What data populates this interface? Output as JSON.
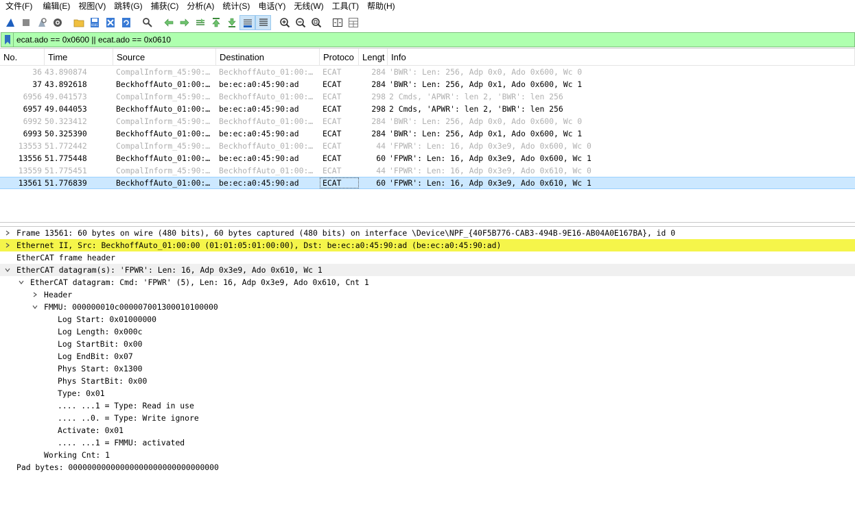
{
  "menu": [
    "文件(F)",
    "编辑(E)",
    "视图(V)",
    "跳转(G)",
    "捕获(C)",
    "分析(A)",
    "统计(S)",
    "电话(Y)",
    "无线(W)",
    "工具(T)",
    "帮助(H)"
  ],
  "toolbar": {
    "icons": [
      "shark-fin-start-icon",
      "stop-icon",
      "restart-icon",
      "options-gear-icon",
      "open-folder-icon",
      "save-file-icon",
      "close-file-icon",
      "reload-icon",
      "find-icon",
      "go-back-icon",
      "go-forward-icon",
      "go-to-packet-icon",
      "go-first-icon",
      "go-last-icon",
      "autoscroll-icon",
      "colorize-icon",
      "zoom-in-icon",
      "zoom-out-icon",
      "zoom-normal-icon",
      "resize-columns-icon",
      "layout-icon"
    ]
  },
  "filter": {
    "value": "ecat.ado == 0x0600 || ecat.ado == 0x0610"
  },
  "columns": [
    "No.",
    "Time",
    "Source",
    "Destination",
    "Protoco",
    "Lengt",
    "Info"
  ],
  "packets": [
    {
      "no": "36",
      "time": "43.890874",
      "src": "CompalInform_45:90:…",
      "dst": "BeckhoffAuto_01:00:…",
      "proto": "ECAT",
      "len": "284",
      "info": "'BWR': Len: 256, Adp 0x0, Ado 0x600, Wc 0",
      "dim": true
    },
    {
      "no": "37",
      "time": "43.892618",
      "src": "BeckhoffAuto_01:00:…",
      "dst": "be:ec:a0:45:90:ad",
      "proto": "ECAT",
      "len": "284",
      "info": "'BWR': Len: 256, Adp 0x1, Ado 0x600, Wc 1",
      "dim": false
    },
    {
      "no": "6956",
      "time": "49.041573",
      "src": "CompalInform_45:90:…",
      "dst": "BeckhoffAuto_01:00:…",
      "proto": "ECAT",
      "len": "298",
      "info": "2 Cmds, 'APWR': len 2, 'BWR': len 256",
      "dim": true
    },
    {
      "no": "6957",
      "time": "49.044053",
      "src": "BeckhoffAuto_01:00:…",
      "dst": "be:ec:a0:45:90:ad",
      "proto": "ECAT",
      "len": "298",
      "info": "2 Cmds, 'APWR': len 2, 'BWR': len 256",
      "dim": false
    },
    {
      "no": "6992",
      "time": "50.323412",
      "src": "CompalInform_45:90:…",
      "dst": "BeckhoffAuto_01:00:…",
      "proto": "ECAT",
      "len": "284",
      "info": "'BWR': Len: 256, Adp 0x0, Ado 0x600, Wc 0",
      "dim": true
    },
    {
      "no": "6993",
      "time": "50.325390",
      "src": "BeckhoffAuto_01:00:…",
      "dst": "be:ec:a0:45:90:ad",
      "proto": "ECAT",
      "len": "284",
      "info": "'BWR': Len: 256, Adp 0x1, Ado 0x600, Wc 1",
      "dim": false
    },
    {
      "no": "13553",
      "time": "51.772442",
      "src": "CompalInform_45:90:…",
      "dst": "BeckhoffAuto_01:00:…",
      "proto": "ECAT",
      "len": "44",
      "info": "'FPWR': Len: 16, Adp 0x3e9, Ado 0x600, Wc 0",
      "dim": true
    },
    {
      "no": "13556",
      "time": "51.775448",
      "src": "BeckhoffAuto_01:00:…",
      "dst": "be:ec:a0:45:90:ad",
      "proto": "ECAT",
      "len": "60",
      "info": "'FPWR': Len: 16, Adp 0x3e9, Ado 0x600, Wc 1",
      "dim": false
    },
    {
      "no": "13559",
      "time": "51.775451",
      "src": "CompalInform_45:90:…",
      "dst": "BeckhoffAuto_01:00:…",
      "proto": "ECAT",
      "len": "44",
      "info": "'FPWR': Len: 16, Adp 0x3e9, Ado 0x610, Wc 0",
      "dim": true
    },
    {
      "no": "13561",
      "time": "51.776839",
      "src": "BeckhoffAuto_01:00:…",
      "dst": "be:ec:a0:45:90:ad",
      "proto": "ECAT",
      "len": "60",
      "info": "'FPWR': Len: 16, Adp 0x3e9, Ado 0x610, Wc 1",
      "dim": false,
      "selected": true
    }
  ],
  "details": [
    {
      "level": 0,
      "arrow": "right",
      "text": "Frame 13561: 60 bytes on wire (480 bits), 60 bytes captured (480 bits) on interface \\Device\\NPF_{40F5B776-CAB3-494B-9E16-AB04A0E167BA}, id 0"
    },
    {
      "level": 0,
      "arrow": "right",
      "text": "Ethernet II, Src: BeckhoffAuto_01:00:00 (01:01:05:01:00:00), Dst: be:ec:a0:45:90:ad (be:ec:a0:45:90:ad)",
      "highlight": true
    },
    {
      "level": 0,
      "arrow": "none",
      "text": "EtherCAT frame header"
    },
    {
      "level": 0,
      "arrow": "down",
      "text": "EtherCAT datagram(s): 'FPWR': Len: 16, Adp 0x3e9, Ado 0x610, Wc 1",
      "selected": true
    },
    {
      "level": 1,
      "arrow": "down",
      "text": "EtherCAT datagram: Cmd: 'FPWR' (5), Len: 16, Adp 0x3e9, Ado 0x610, Cnt 1"
    },
    {
      "level": 2,
      "arrow": "right",
      "text": "Header"
    },
    {
      "level": 2,
      "arrow": "down",
      "text": "FMMU: 000000010c000007001300010100000"
    },
    {
      "level": 3,
      "arrow": "none",
      "text": "Log Start: 0x01000000"
    },
    {
      "level": 3,
      "arrow": "none",
      "text": "Log Length: 0x000c"
    },
    {
      "level": 3,
      "arrow": "none",
      "text": "Log StartBit: 0x00"
    },
    {
      "level": 3,
      "arrow": "none",
      "text": "Log EndBit: 0x07"
    },
    {
      "level": 3,
      "arrow": "none",
      "text": "Phys Start: 0x1300"
    },
    {
      "level": 3,
      "arrow": "none",
      "text": "Phys StartBit: 0x00"
    },
    {
      "level": 3,
      "arrow": "none",
      "text": "Type: 0x01"
    },
    {
      "level": 3,
      "arrow": "none",
      "text": ".... ...1 = Type: Read in use"
    },
    {
      "level": 3,
      "arrow": "none",
      "text": ".... ..0. = Type: Write ignore"
    },
    {
      "level": 3,
      "arrow": "none",
      "text": "Activate: 0x01"
    },
    {
      "level": 3,
      "arrow": "none",
      "text": ".... ...1 = FMMU: activated"
    },
    {
      "level": 2,
      "arrow": "none",
      "text": "Working Cnt: 1"
    },
    {
      "level": 0,
      "arrow": "none",
      "text": "Pad bytes: 00000000000000000000000000000000"
    }
  ]
}
